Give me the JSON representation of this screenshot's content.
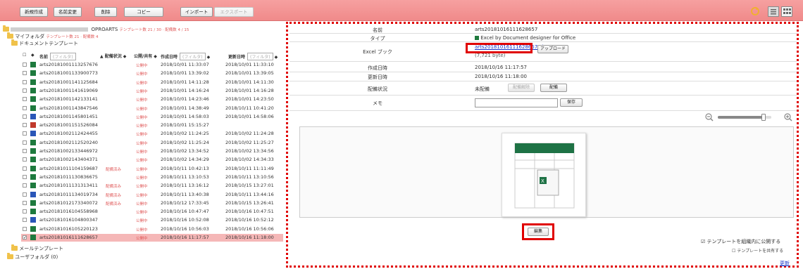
{
  "toolbar": {
    "buttons": [
      "新規作成",
      "名前変更",
      "削除",
      "コピー"
    ],
    "import_label": "インポート",
    "export_label": "エクスポート",
    "refresh_icon": "refresh-icon",
    "view_icons": [
      "list-view-icon",
      "grid-view-icon"
    ]
  },
  "tree": {
    "root_label": "OPROARTS",
    "root_meta": "テンプレート数 21 / 30 · 配備数 4 / 15",
    "my_folder": "マイフォルダ",
    "my_folder_meta": "テンプレート数 21 · 配備数 4",
    "doc_templates": "ドキュメントテンプレート",
    "mail_templates": "メールテンプレート",
    "user_folder": "ユーザフォルダ (0)"
  },
  "table": {
    "headers": {
      "name": "名前",
      "status": "配備状況",
      "public": "公開/共有",
      "created": "作成日時",
      "updated": "更新日時",
      "filter": "(フィルタ)"
    },
    "rows": [
      {
        "name": "arts20181001113257676",
        "status": "",
        "public": "公開中",
        "created": "2018/10/01 11:33:07",
        "updated": "2018/10/01 11:33:10",
        "icon": "green",
        "selected": false
      },
      {
        "name": "arts20181001133900773",
        "status": "",
        "public": "公開中",
        "created": "2018/10/01 13:39:02",
        "updated": "2018/10/01 13:39:05",
        "icon": "green",
        "selected": false
      },
      {
        "name": "arts20181001141125684",
        "status": "",
        "public": "公開中",
        "created": "2018/10/01 14:11:28",
        "updated": "2018/10/01 14:11:30",
        "icon": "green",
        "selected": false
      },
      {
        "name": "arts20181001141619069",
        "status": "",
        "public": "公開中",
        "created": "2018/10/01 14:16:24",
        "updated": "2018/10/01 14:16:28",
        "icon": "green",
        "selected": false
      },
      {
        "name": "arts20181001142133141",
        "status": "",
        "public": "公開中",
        "created": "2018/10/01 14:23:46",
        "updated": "2018/10/01 14:23:50",
        "icon": "green",
        "selected": false
      },
      {
        "name": "arts20181001143847546",
        "status": "",
        "public": "公開中",
        "created": "2018/10/01 14:38:49",
        "updated": "2018/10/11 10:41:20",
        "icon": "green",
        "selected": false
      },
      {
        "name": "arts20181001145801451",
        "status": "",
        "public": "公開中",
        "created": "2018/10/01 14:58:03",
        "updated": "2018/10/01 14:58:06",
        "icon": "blue",
        "selected": false
      },
      {
        "name": "arts20181001151526084",
        "status": "",
        "public": "公開中",
        "created": "2018/10/01 15:15:27",
        "updated": "",
        "icon": "other",
        "selected": false
      },
      {
        "name": "arts20181002112424455",
        "status": "",
        "public": "公開中",
        "created": "2018/10/02 11:24:25",
        "updated": "2018/10/02 11:24:28",
        "icon": "blue",
        "selected": false
      },
      {
        "name": "arts20181002112520240",
        "status": "",
        "public": "公開中",
        "created": "2018/10/02 11:25:24",
        "updated": "2018/10/02 11:25:27",
        "icon": "green",
        "selected": false
      },
      {
        "name": "arts20181002133446972",
        "status": "",
        "public": "公開中",
        "created": "2018/10/02 13:34:52",
        "updated": "2018/10/02 13:34:56",
        "icon": "green",
        "selected": false
      },
      {
        "name": "arts20181002143404371",
        "status": "",
        "public": "公開中",
        "created": "2018/10/02 14:34:29",
        "updated": "2018/10/02 14:34:33",
        "icon": "green",
        "selected": false
      },
      {
        "name": "arts20181011104159687",
        "status": "配備済み",
        "public": "公開中",
        "created": "2018/10/11 10:42:13",
        "updated": "2018/10/11 11:11:49",
        "icon": "green",
        "selected": false
      },
      {
        "name": "arts20181011130836675",
        "status": "",
        "public": "公開中",
        "created": "2018/10/11 13:10:53",
        "updated": "2018/10/11 13:10:56",
        "icon": "green",
        "selected": false
      },
      {
        "name": "arts20181011131313411",
        "status": "配備済み",
        "public": "公開中",
        "created": "2018/10/11 13:16:12",
        "updated": "2018/10/15 13:27:01",
        "icon": "green",
        "selected": false
      },
      {
        "name": "arts20181011134019734",
        "status": "配備済み",
        "public": "公開中",
        "created": "2018/10/11 13:40:38",
        "updated": "2018/10/11 13:44:16",
        "icon": "blue",
        "selected": false
      },
      {
        "name": "arts20181012173340072",
        "status": "配備済み",
        "public": "公開中",
        "created": "2018/10/12 17:33:45",
        "updated": "2018/10/15 13:26:41",
        "icon": "green",
        "selected": false
      },
      {
        "name": "arts20181016104558968",
        "status": "",
        "public": "公開中",
        "created": "2018/10/16 10:47:47",
        "updated": "2018/10/16 10:47:51",
        "icon": "green",
        "selected": false
      },
      {
        "name": "arts20181016104800347",
        "status": "",
        "public": "公開中",
        "created": "2018/10/16 10:52:08",
        "updated": "2018/10/16 10:52:12",
        "icon": "blue",
        "selected": false
      },
      {
        "name": "arts20181016105220123",
        "status": "",
        "public": "公開中",
        "created": "2018/10/16 10:56:03",
        "updated": "2018/10/16 10:56:06",
        "icon": "green",
        "selected": false
      },
      {
        "name": "arts20181016111628657",
        "status": "",
        "public": "公開中",
        "created": "2018/10/16 11:17:57",
        "updated": "2018/10/16 11:18:00",
        "icon": "green",
        "selected": true
      }
    ]
  },
  "details": {
    "name_label": "名前",
    "name_value": "arts20181016111628657",
    "type_label": "タイプ",
    "type_value": "Excel by Document designer for Office",
    "excel_label": "Excel ブック",
    "excel_file": "arts20181016111628657.xlsx",
    "excel_size": "(7,721 byte)",
    "upload_label": "アップロード",
    "created_label": "作成日時",
    "created_value": "2018/10/16 11:17:57",
    "updated_label": "更新日時",
    "updated_value": "2018/10/16 11:18:00",
    "deploy_label": "配備状況",
    "deploy_value": "未配備",
    "undeploy_btn": "配備解除",
    "deploy_btn": "配備",
    "memo_label": "メモ",
    "memo_value": "",
    "save_btn": "保存",
    "edit_btn": "編集",
    "publish_label": "テンプレートを組織内に公開する",
    "share_label": "テンプレートを共有する",
    "refresh_link": "更新",
    "zoom_level": 0.85
  },
  "colors": {
    "toolbar": "#f08a8a",
    "selected_row": "#f5b7b7",
    "highlight_red": "#e00000",
    "status_text": "#e05a5a",
    "link": "#1a35c8"
  }
}
